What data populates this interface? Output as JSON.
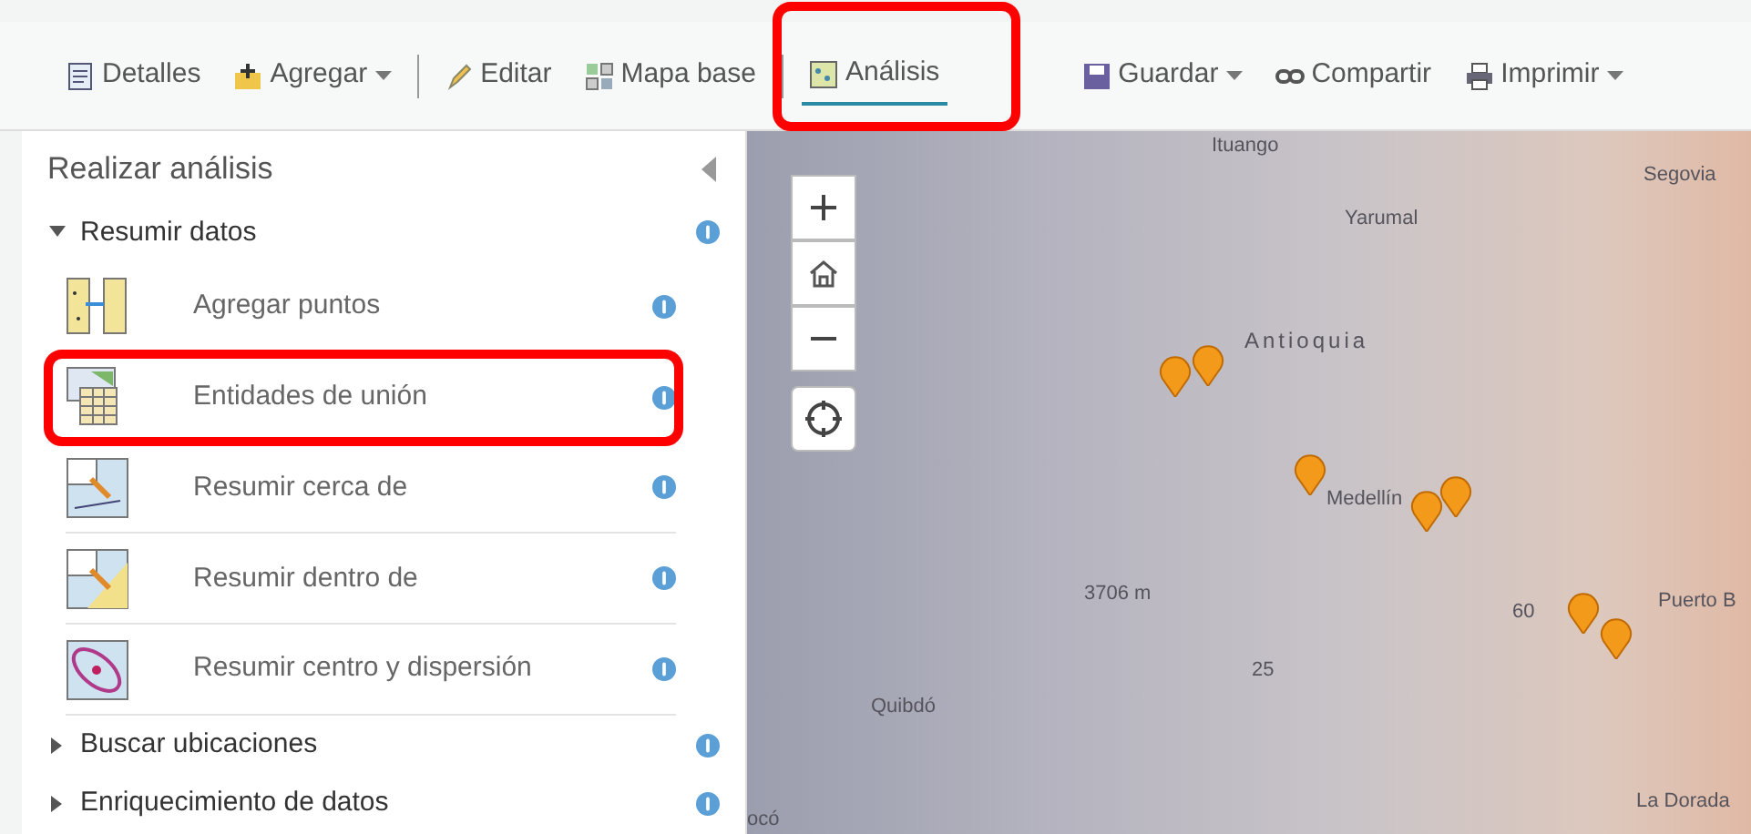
{
  "toolbar": [
    {
      "label": "Detalles",
      "dropdown": false,
      "selected": false,
      "highlighted": false
    },
    {
      "label": "Agregar",
      "dropdown": true,
      "selected": false,
      "highlighted": false
    },
    {
      "label": "Editar",
      "dropdown": false,
      "selected": false,
      "highlighted": false
    },
    {
      "label": "Mapa base",
      "dropdown": false,
      "selected": false,
      "highlighted": false
    },
    {
      "label": "Análisis",
      "dropdown": false,
      "selected": true,
      "highlighted": true
    },
    {
      "label": "Guardar",
      "dropdown": true,
      "selected": false,
      "highlighted": false
    },
    {
      "label": "Compartir",
      "dropdown": false,
      "selected": false,
      "highlighted": false
    },
    {
      "label": "Imprimir",
      "dropdown": true,
      "selected": false,
      "highlighted": false
    }
  ],
  "panel": {
    "title": "Realizar análisis",
    "sections": [
      {
        "label": "Resumir datos",
        "expanded": true,
        "tools": [
          {
            "label": "Agregar puntos",
            "highlighted": false
          },
          {
            "label": "Entidades de unión",
            "highlighted": true
          },
          {
            "label": "Resumir cerca de",
            "highlighted": false
          },
          {
            "label": "Resumir dentro de",
            "highlighted": false
          },
          {
            "label": "Resumir centro y dispersión",
            "highlighted": false
          }
        ]
      },
      {
        "label": "Buscar ubicaciones",
        "expanded": false
      },
      {
        "label": "Enriquecimiento de datos",
        "expanded": false
      }
    ]
  },
  "map": {
    "labels": [
      "Ituango",
      "Segovia",
      "Yarumal",
      "Antioquia",
      "Medellín",
      "3706 m",
      "60",
      "Puerto B",
      "25",
      "Quibdó",
      "ocó",
      "La Dorada"
    ]
  }
}
